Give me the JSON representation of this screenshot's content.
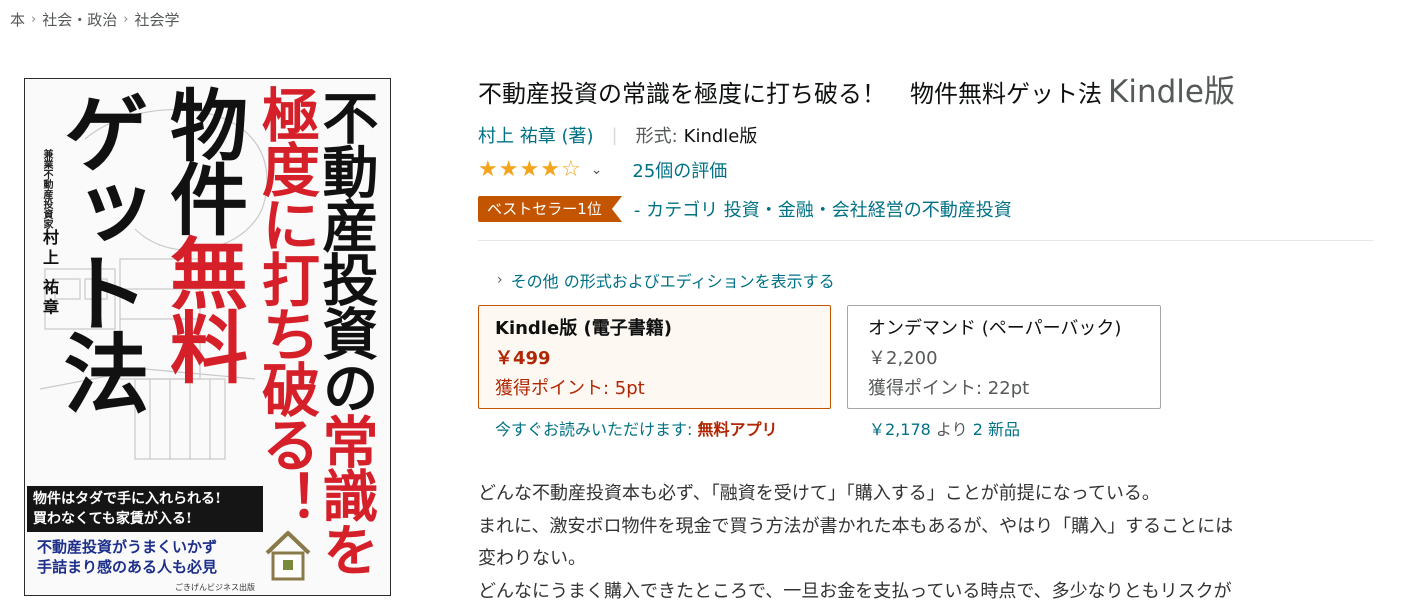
{
  "breadcrumb": {
    "items": [
      "本",
      "社会・政治",
      "社会学"
    ]
  },
  "cover": {
    "title_line1a": "不動産投資の",
    "title_line1b": "常識を",
    "title_line2": "極度に打ち破る！",
    "title_line3a": "物件",
    "title_line3b": "無料",
    "title_line4": "ゲット法",
    "author_caption": "兼業不動産投資家",
    "author": "村上 祐章",
    "band_line1": "物件はタダで手に入れられる!",
    "band_line2": "買わなくても家賃が入る!",
    "blue_line1": "不動産投資がうまくいかず",
    "blue_line2": "手詰まり感のある人も必見",
    "publisher": "ごきげんビジネス出版"
  },
  "product": {
    "title": "不動産投資の常識を極度に打ち破る！　物件無料ゲット法",
    "format_suffix": "Kindle版",
    "author": "村上 祐章 (著)",
    "format_label": "形式:",
    "format_value": "Kindle版",
    "rating_stars": 4,
    "rating_max": 5,
    "rating_count": "25個の評価",
    "bestseller_badge": "ベストセラー1位",
    "bestseller_category": "- カテゴリ 投資・金融・会社経営の不動産投資",
    "other_formats_link": "その他 の形式およびエディションを表示する"
  },
  "swatches": [
    {
      "name": "Kindle版 (電子書籍)",
      "price": "￥499",
      "points": "獲得ポイント: 5pt",
      "selected": true
    },
    {
      "name": "オンデマンド (ペーパーバック)",
      "price": "￥2,200",
      "points": "獲得ポイント: 22pt",
      "selected": false
    }
  ],
  "below_swatches": {
    "left_text": "今すぐお読みいただけます: ",
    "left_bold": "無料アプリ",
    "right_price": "￥2,178 ",
    "right_yori": "より ",
    "right_new": "2 新品"
  },
  "description": [
    "どんな不動産投資本も必ず、「融資を受けて」「購入する」ことが前提になっている。",
    "まれに、激安ボロ物件を現金で買う方法が書かれた本もあるが、やはり「購入」することには",
    "変わりない。",
    "どんなにうまく購入できたところで、一旦お金を支払っている時点で、多少なりともリスクが"
  ],
  "colors": {
    "link": "#007185",
    "price": "#b12704",
    "star": "#f4a41c",
    "badge": "#c45500",
    "cover_red": "#d5202a"
  }
}
